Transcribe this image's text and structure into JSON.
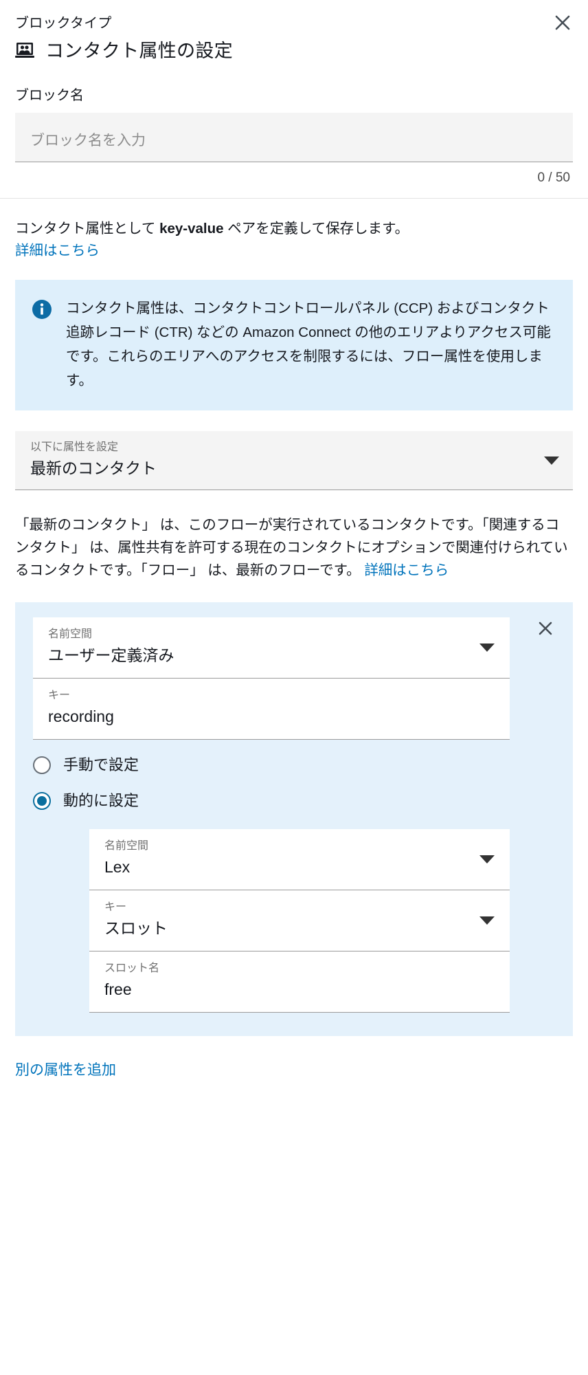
{
  "header": {
    "block_type_label": "ブロックタイプ",
    "title": "コンタクト属性の設定",
    "block_icon": "contact-attributes-icon",
    "close_icon": "close-icon"
  },
  "block_name": {
    "label": "ブロック名",
    "placeholder": "ブロック名を入力",
    "value": "",
    "counter": "0 / 50"
  },
  "description": {
    "line_start": "コンタクト属性として ",
    "bold": "key-value",
    "line_end": " ペアを定義して保存します。",
    "link": "詳細はこちら"
  },
  "alert": {
    "icon": "info-icon",
    "text": "コンタクト属性は、コンタクトコントロールパネル (CCP) およびコンタクト追跡レコード (CTR) などの Amazon Connect の他のエリアよりアクセス可能です。これらのエリアへのアクセスを制限するには、フロー属性を使用します。"
  },
  "target_select": {
    "mini_label": "以下に属性を設定",
    "value": "最新のコンタクト",
    "caret_icon": "chevron-down-icon"
  },
  "explanation": {
    "text": "「最新のコンタクト」 は、このフローが実行されているコンタクトです。「関連するコンタクト」 は、属性共有を許可する現在のコンタクトにオプションで関連付けられているコンタクトです。「フロー」 は、最新のフローです。 ",
    "link": "詳細はこちら"
  },
  "attribute_panel": {
    "close_icon": "close-icon",
    "namespace": {
      "mini_label": "名前空間",
      "value": "ユーザー定義済み",
      "caret_icon": "chevron-down-icon"
    },
    "key": {
      "mini_label": "キー",
      "value": "recording"
    },
    "radios": [
      {
        "label": "手動で設定",
        "checked": false
      },
      {
        "label": "動的に設定",
        "checked": true
      }
    ],
    "dynamic": {
      "namespace": {
        "mini_label": "名前空間",
        "value": "Lex",
        "caret_icon": "chevron-down-icon"
      },
      "key": {
        "mini_label": "キー",
        "value": "スロット",
        "caret_icon": "chevron-down-icon"
      },
      "slot_name": {
        "mini_label": "スロット名",
        "value": "free"
      }
    }
  },
  "footer": {
    "add_attribute_link": "別の属性を追加"
  },
  "colors": {
    "link": "#0073bb",
    "alert_bg": "#deeffb",
    "panel_bg": "#e4f1fb",
    "radio_accent": "#0a6f9e",
    "input_bg": "#f4f4f4"
  }
}
